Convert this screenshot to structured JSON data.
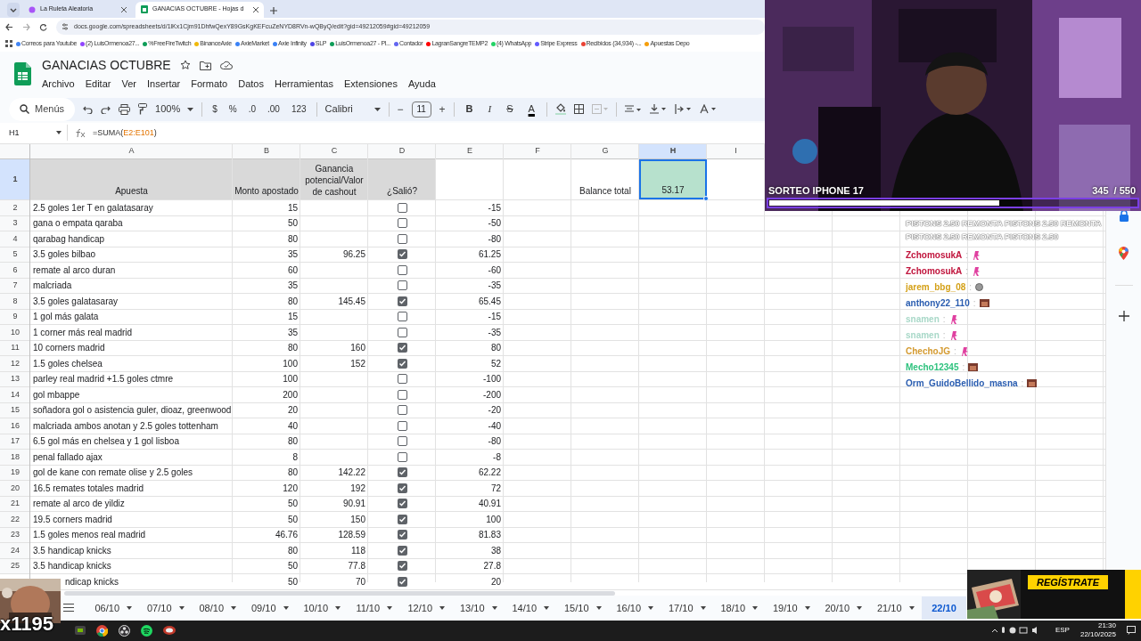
{
  "browser": {
    "tabs": [
      {
        "label": "La Ruleta Aleatoria",
        "selected": false
      },
      {
        "label": "GANACIAS OCTUBRE - Hojas d",
        "selected": true
      }
    ],
    "url": "docs.google.com/spreadsheets/d/1lKx1Cjm91DhfwQexY89GsKgKEFcuZeNYD8RVn-wQByQ/edit?gid=49212059#gid=49212059",
    "bookmarks": [
      {
        "label": "Correos para Youtube",
        "color": "#4285f4"
      },
      {
        "label": "(2) LuisOrmenoa27...",
        "color": "#9146ff"
      },
      {
        "label": "%FreeFireTwitch",
        "color": "#0f9d58"
      },
      {
        "label": "BinanceAxie",
        "color": "#f0b90b"
      },
      {
        "label": "AxieMarket",
        "color": "#3b82f6"
      },
      {
        "label": "Axie Infinity",
        "color": "#3b82f6"
      },
      {
        "label": "SLP",
        "color": "#4f46e5"
      },
      {
        "label": "LuisOrmenoa27 - Pl...",
        "color": "#0f9d58"
      },
      {
        "label": "Contador",
        "color": "#6366f1"
      },
      {
        "label": "LagranSangreTEMP2",
        "color": "#ff0000"
      },
      {
        "label": "(4) WhatsApp",
        "color": "#25d366"
      },
      {
        "label": "Stripe Express",
        "color": "#635bff"
      },
      {
        "label": "Recibidos (34,934) -...",
        "color": "#ea4335"
      },
      {
        "label": "Apuestas Depo",
        "color": "#f59e0b"
      }
    ]
  },
  "sheet": {
    "title": "GANACIAS OCTUBRE",
    "menu": [
      "Archivo",
      "Editar",
      "Ver",
      "Insertar",
      "Formato",
      "Datos",
      "Herramientas",
      "Extensiones",
      "Ayuda"
    ],
    "toolbar": {
      "search": "Menús",
      "zoom": "100%",
      "number_formats": [
        "$",
        "%",
        ".0",
        ".00",
        "123"
      ],
      "font": "Calibri",
      "font_size": "11",
      "minus": "−",
      "plus": "+",
      "styles": [
        {
          "label": "B",
          "kind": "bold"
        },
        {
          "label": "I",
          "kind": "italic"
        },
        {
          "label": "S",
          "kind": "strike"
        },
        {
          "label": "A",
          "kind": "color"
        }
      ]
    },
    "name_box": "H1",
    "formula_parts": [
      {
        "text": "=SUMA(",
        "kind": "plain"
      },
      {
        "text": "E2:E101",
        "kind": "ref"
      },
      {
        "text": ")",
        "kind": "plain"
      }
    ],
    "columns": [
      {
        "label": "A",
        "selected": false
      },
      {
        "label": "B",
        "selected": false
      },
      {
        "label": "C",
        "selected": false
      },
      {
        "label": "D",
        "selected": false
      },
      {
        "label": "E",
        "selected": false
      },
      {
        "label": "F",
        "selected": false
      },
      {
        "label": "G",
        "selected": false
      },
      {
        "label": "H",
        "selected": true
      },
      {
        "label": "I",
        "selected": false
      }
    ],
    "header_row": {
      "num": "1",
      "selected": true,
      "apuesta": "Apuesta",
      "monto": "Monto apostado",
      "ganancia": "Ganancia potencial/Valor de cashout",
      "salio": "¿Salió?",
      "balance_label": "Balance total",
      "balance": "53.17"
    },
    "rows": [
      {
        "num": "2",
        "a": "2.5 goles 1er T en galatasaray",
        "b": "15",
        "checked": false,
        "e": "-15"
      },
      {
        "num": "3",
        "a": "gana o empata qaraba",
        "b": "50",
        "checked": false,
        "e": "-50"
      },
      {
        "num": "4",
        "a": "qarabag handicap",
        "b": "80",
        "checked": false,
        "e": "-80"
      },
      {
        "num": "5",
        "a": "3.5 goles bilbao",
        "b": "35",
        "c": "96.25",
        "checked": true,
        "e": "61.25"
      },
      {
        "num": "6",
        "a": "remate al arco duran",
        "b": "60",
        "checked": false,
        "e": "-60"
      },
      {
        "num": "7",
        "a": "malcriada",
        "b": "35",
        "checked": false,
        "e": "-35"
      },
      {
        "num": "8",
        "a": "3.5 goles galatasaray",
        "b": "80",
        "c": "145.45",
        "checked": true,
        "e": "65.45"
      },
      {
        "num": "9",
        "a": "1 gol más galata",
        "b": "15",
        "checked": false,
        "e": "-15"
      },
      {
        "num": "10",
        "a": "1 corner más real madrid",
        "b": "35",
        "checked": false,
        "e": "-35"
      },
      {
        "num": "11",
        "a": "10 corners madrid",
        "b": "80",
        "c": "160",
        "checked": true,
        "e": "80"
      },
      {
        "num": "12",
        "a": "1.5 goles chelsea",
        "b": "100",
        "c": "152",
        "checked": true,
        "e": "52"
      },
      {
        "num": "13",
        "a": "parley real madrid +1.5 goles ctmre",
        "b": "100",
        "checked": false,
        "e": "-100"
      },
      {
        "num": "14",
        "a": "gol mbappe",
        "b": "200",
        "checked": false,
        "e": "-200"
      },
      {
        "num": "15",
        "a": "soñadora gol o asistencia guler, dioaz, greenwood",
        "b": "20",
        "checked": false,
        "e": "-20"
      },
      {
        "num": "16",
        "a": "malcriada ambos anotan y 2.5 goles tottenham",
        "b": "40",
        "checked": false,
        "e": "-40"
      },
      {
        "num": "17",
        "a": "6.5 gol más en chelsea y 1 gol lisboa",
        "b": "80",
        "checked": false,
        "e": "-80"
      },
      {
        "num": "18",
        "a": "penal fallado ajax",
        "b": "8",
        "checked": false,
        "e": "-8"
      },
      {
        "num": "19",
        "a": "gol de kane con remate olise y 2.5 goles",
        "b": "80",
        "c": "142.22",
        "checked": true,
        "e": "62.22"
      },
      {
        "num": "20",
        "a": "16.5 remates totales madrid",
        "b": "120",
        "c": "192",
        "checked": true,
        "e": "72"
      },
      {
        "num": "21",
        "a": "remate al arco de yildiz",
        "b": "50",
        "c": "90.91",
        "checked": true,
        "e": "40.91"
      },
      {
        "num": "22",
        "a": "19.5 corners madrid",
        "b": "50",
        "c": "150",
        "checked": true,
        "e": "100"
      },
      {
        "num": "23",
        "a": "1.5 goles menos real madrid",
        "b": "46.76",
        "c": "128.59",
        "checked": true,
        "e": "81.83"
      },
      {
        "num": "24",
        "a": "3.5 handicap knicks",
        "b": "80",
        "c": "118",
        "checked": true,
        "e": "38"
      },
      {
        "num": "25",
        "a": "3.5 handicap knicks",
        "b": "50",
        "c": "77.8",
        "checked": true,
        "e": "27.8"
      },
      {
        "a": "ndicap knicks",
        "b": "50",
        "c": "70",
        "checked": true,
        "e": "20",
        "covered": true
      }
    ],
    "sheet_tabs": [
      {
        "label": "06/10",
        "selected": false
      },
      {
        "label": "07/10",
        "selected": false
      },
      {
        "label": "08/10",
        "selected": false
      },
      {
        "label": "09/10",
        "selected": false
      },
      {
        "label": "10/10",
        "selected": false
      },
      {
        "label": "11/10",
        "selected": false
      },
      {
        "label": "12/10",
        "selected": false
      },
      {
        "label": "13/10",
        "selected": false
      },
      {
        "label": "14/10",
        "selected": false
      },
      {
        "label": "15/10",
        "selected": false
      },
      {
        "label": "16/10",
        "selected": false
      },
      {
        "label": "17/10",
        "selected": false
      },
      {
        "label": "18/10",
        "selected": false
      },
      {
        "label": "19/10",
        "selected": false
      },
      {
        "label": "20/10",
        "selected": false
      },
      {
        "label": "21/10",
        "selected": false
      },
      {
        "label": "22/10",
        "selected": true
      }
    ]
  },
  "stream": {
    "goal": {
      "title": "SORTEO IPHONE 17",
      "current": "345",
      "total": "/ 550",
      "level": 0.627
    },
    "chat": [
      {
        "kind": "banner",
        "text": "PISTONS 2.50 REMONTA PISTONS 2.50 REMONTA PISTONS 2.50 REMONTA PISTONS 2.50"
      },
      {
        "kind": "user",
        "user": "ZchomosukA",
        "color": "#c0143c",
        "sep": ":",
        "emote": {
          "kind": "glyph"
        }
      },
      {
        "kind": "user",
        "user": "ZchomosukA",
        "color": "#c0143c",
        "sep": ":",
        "emote": {
          "kind": "glyph"
        }
      },
      {
        "kind": "user",
        "user": "jarem_bbg_08",
        "color": "#d4a017",
        "sep": ":",
        "emote": {
          "kind": "ball"
        }
      },
      {
        "kind": "user",
        "user": "anthony22_110",
        "color": "#2a5db0",
        "sep": ":"
      },
      {
        "kind": "user",
        "user": "snamen",
        "color": "#a8d8c8",
        "sep": ":",
        "emote": {
          "kind": "glyph"
        }
      },
      {
        "kind": "user",
        "user": "snamen",
        "color": "#a8d8c8",
        "sep": ":",
        "emote": {
          "kind": "glyph"
        }
      },
      {
        "kind": "user",
        "user": "ChechoJG",
        "color": "#d49a30",
        "sep": ":",
        "emote": {
          "kind": "glyph"
        }
      },
      {
        "kind": "user",
        "user": "Mecho12345",
        "color": "#2ec27e",
        "sep": ":"
      },
      {
        "kind": "user",
        "user": "Orm_GuidoBellido_masna",
        "color": "#2a5db0",
        "sep": ":"
      }
    ],
    "emote_counter": "x1195",
    "banner": "REGÍSTRATE"
  },
  "taskbar": {
    "icons": [
      {
        "kind": "nvidia"
      },
      {
        "kind": "chrome"
      },
      {
        "kind": "obs"
      },
      {
        "kind": "spotify"
      },
      {
        "kind": "app"
      }
    ],
    "language": "ESP",
    "time": "21:30",
    "date": "22/10/2025"
  }
}
